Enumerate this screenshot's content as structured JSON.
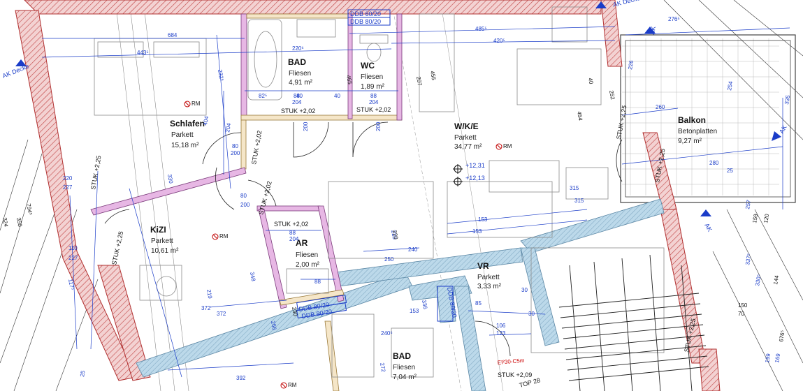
{
  "colors": {
    "outer_wall": "#f3d2d2",
    "outer_hatch": "#c04040",
    "inner_wall": "#f5e6c8",
    "pink_wall": "#e7b7e4",
    "concrete": "#bcd9ea",
    "dimension": "#1a3cc8",
    "furniture": "#8a8a8a",
    "marker": "#c00000"
  },
  "rooms": [
    {
      "name": "Schlafen",
      "finish": "Parkett",
      "area": "15,18 m²"
    },
    {
      "name": "BAD",
      "finish": "Fliesen",
      "area": "4,91 m²"
    },
    {
      "name": "WC",
      "finish": "Fliesen",
      "area": "1,89 m²"
    },
    {
      "name": "W/K/E",
      "finish": "Parkett",
      "area": "34,77 m²"
    },
    {
      "name": "Balkon",
      "finish": "Betonplatten",
      "area": "9,27 m²"
    },
    {
      "name": "KiZI",
      "finish": "Parkett",
      "area": "10,61 m²"
    },
    {
      "name": "AR",
      "finish": "Fliesen",
      "area": "2,00 m²"
    },
    {
      "name": "VR",
      "finish": "Parkett",
      "area": "3,33 m²"
    },
    {
      "name": "BAD",
      "finish": "Fliesen",
      "area": "7,04 m²"
    }
  ],
  "stuk": [
    "STUK +2,02",
    "STUK +2,02",
    "STUK +2,02",
    "STUK +2,02",
    "STUK +2,02",
    "STUK +2,25",
    "STUK +2,25",
    "STUK +2,25",
    "STUK +2,25",
    "STUK +2,25",
    "STUK +2,09"
  ],
  "ddb": [
    "DDB 60/20",
    "DDB 80/20",
    "DDB 80/20",
    "DDB 80/20",
    "DDB 80/20"
  ],
  "markers": {
    "rm": "RM",
    "level1": "+12,31",
    "level2": "+12,13",
    "ak_decke": "AK Decke",
    "ak": "AK",
    "fire_door": "EI²30-C5m",
    "top": "TOP 28"
  },
  "dims": {
    "blue": [
      "684",
      "443⁵",
      "220⁶",
      "485⁵",
      "420⁵",
      "276⁵",
      "335",
      "232⁵",
      "82⁵",
      "40",
      "40",
      "204",
      "88",
      "204",
      "88",
      "200",
      "200",
      "80",
      "80",
      "200",
      "200",
      "88",
      "204",
      "88",
      "204",
      "110",
      "227",
      "220",
      "227",
      "404",
      "330",
      "220",
      "117⁵",
      "348",
      "219",
      "153",
      "153",
      "153",
      "315",
      "315",
      "260",
      "280",
      "226",
      "254",
      "25",
      "257",
      "240",
      "250",
      "240⁵",
      "372",
      "372",
      "106",
      "123",
      "30",
      "30",
      "85",
      "25",
      "392",
      "256",
      "272",
      "336",
      "337⁵",
      "330⁵",
      "169",
      "199"
    ],
    "black": [
      "794⁵",
      "324",
      "350",
      "455",
      "207",
      "465",
      "454",
      "252",
      "40",
      "230",
      "220",
      "159",
      "120",
      "150",
      "70",
      "144",
      "676⁵"
    ]
  }
}
